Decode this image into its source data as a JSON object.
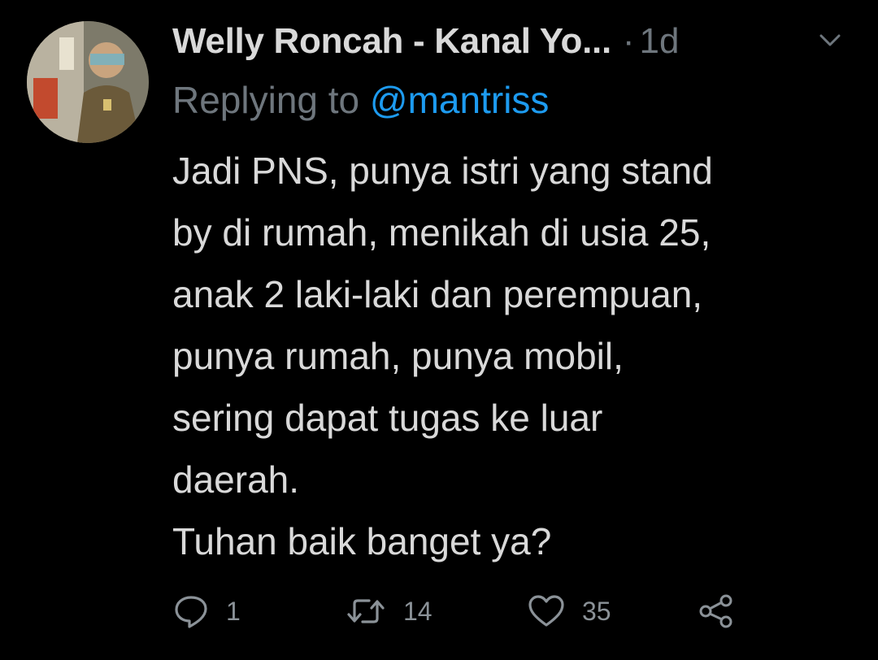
{
  "tweet": {
    "display_name": "Welly Roncah - Kanal Yo...",
    "separator": "·",
    "timestamp": "1d",
    "reply_prefix": "Replying to",
    "reply_handle": "@mantriss",
    "body_lines": [
      "Jadi PNS, punya istri yang stand",
      "by di rumah, menikah di usia 25,",
      "anak 2 laki-laki dan perempuan,",
      "punya rumah, punya mobil,",
      "sering dapat tugas ke luar",
      "daerah.",
      "Tuhan baik banget ya?"
    ],
    "actions": {
      "reply": {
        "icon": "reply-icon",
        "count": "1"
      },
      "retweet": {
        "icon": "retweet-icon",
        "count": "14"
      },
      "like": {
        "icon": "heart-icon",
        "count": "35"
      },
      "share": {
        "icon": "share-icon"
      }
    },
    "menu_icon": "chevron-down-icon",
    "avatar_icon": "avatar"
  },
  "colors": {
    "background": "#000000",
    "text": "#d9d9d9",
    "muted": "#6e767d",
    "link": "#1d9bf0",
    "icon": "#8b9298"
  }
}
